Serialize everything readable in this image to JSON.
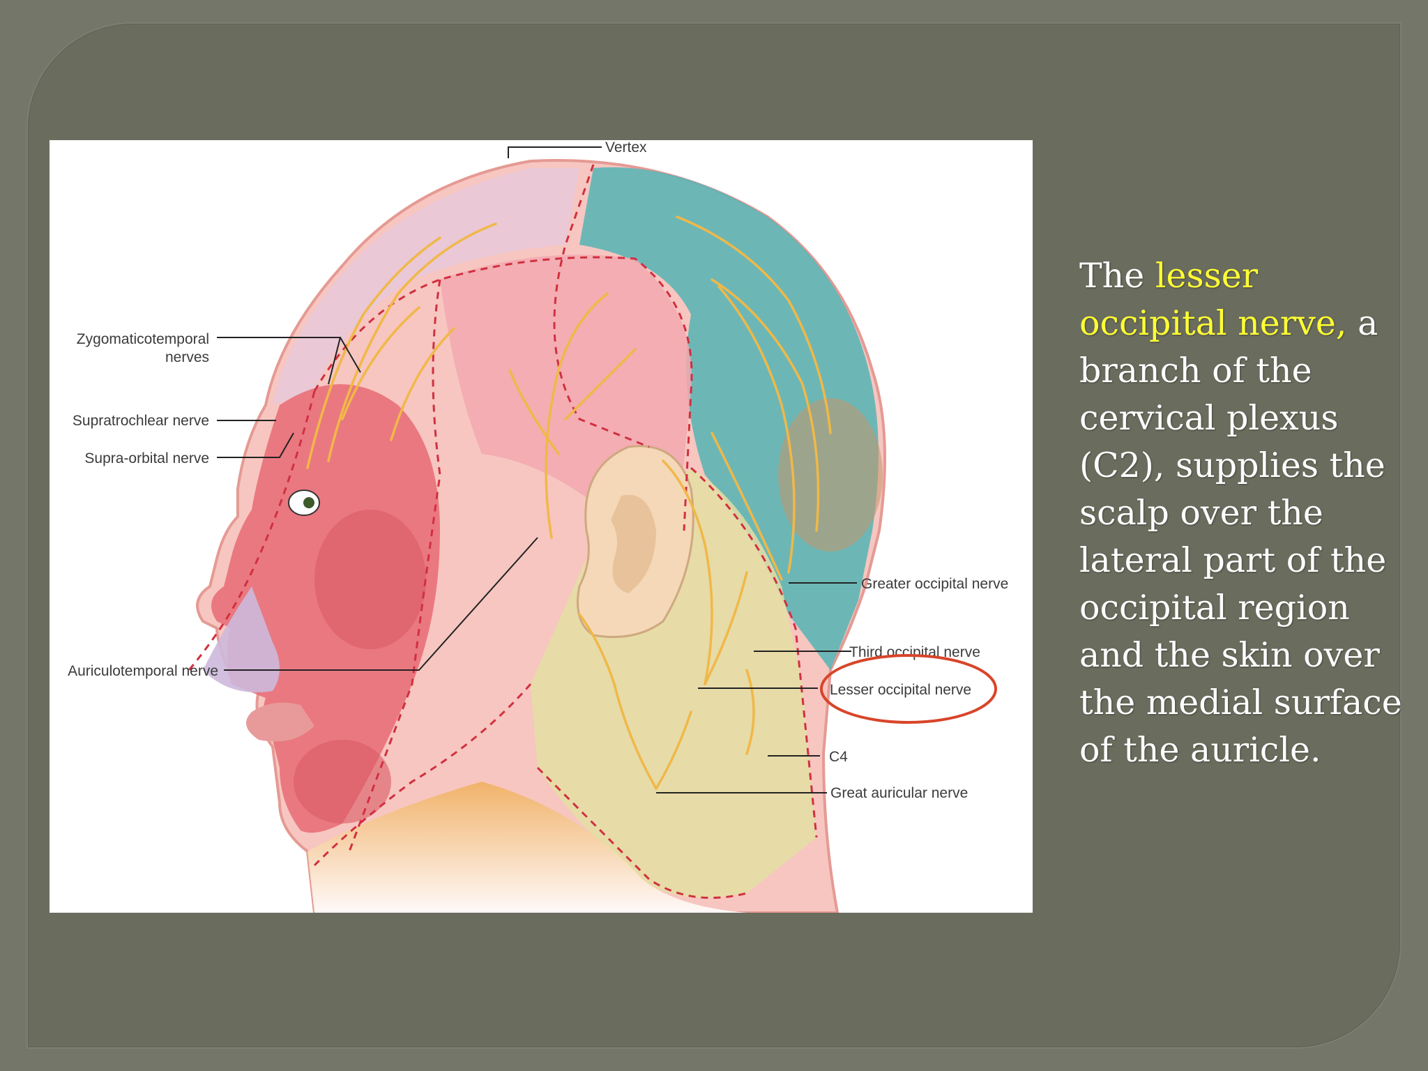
{
  "slide": {
    "labels": {
      "vertex": "Vertex",
      "zygomaticotemporal_1": "Zygomaticotemporal",
      "zygomaticotemporal_2": "nerves",
      "supratrochlear": "Supratrochlear nerve",
      "supraorbital": "Supra-orbital nerve",
      "auriculotemporal": "Auriculotemporal nerve",
      "greater_occipital": "Greater occipital nerve",
      "third_occipital": "Third occipital nerve",
      "lesser_occipital": "Lesser occipital nerve",
      "c4": "C4",
      "great_auricular": "Great auricular nerve"
    },
    "description": {
      "intro": "The",
      "highlight": "lesser occipital nerve,",
      "body": "a branch of the cervical plexus (C2), supplies the scalp over the lateral part of the occipital region and the skin over the medial surface of the auricle."
    }
  },
  "colors": {
    "background": "#6a6c5e",
    "highlight": "#ffff33",
    "circle": "#d8452a"
  }
}
